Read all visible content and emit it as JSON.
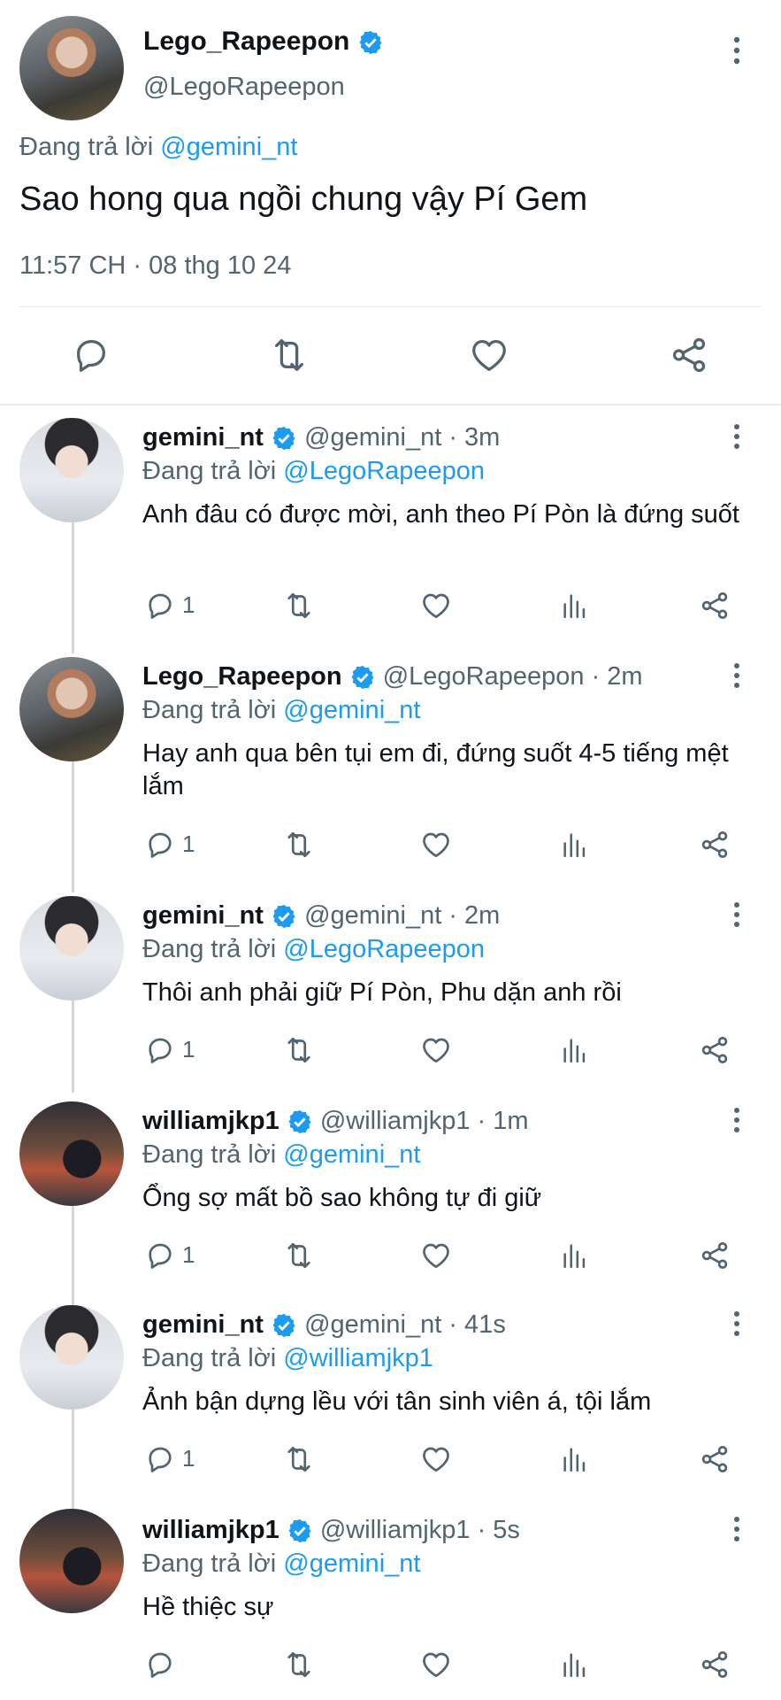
{
  "main_tweet": {
    "display_name": "Lego_Rapeepon",
    "handle": "@LegoRapeepon",
    "reply_prefix": "Đang trả lời",
    "reply_to": "@gemini_nt",
    "text": "Sao hong qua ngồi chung vậy Pí Gem",
    "timestamp": "11:57 CH · 08 thg 10 24",
    "action_icons": [
      "reply-icon",
      "retweet-icon",
      "like-icon",
      "share-icon"
    ]
  },
  "replies": [
    {
      "display_name": "gemini_nt",
      "handle": "@gemini_nt",
      "time": "· 3m",
      "reply_prefix": "Đang trả lời",
      "reply_to": "@LegoRapeepon",
      "text": "Anh đâu có được mời, anh theo Pí Pòn là đứng suốt",
      "reply_count": "1"
    },
    {
      "display_name": "Lego_Rapeepon",
      "handle": "@LegoRapeepon",
      "time": "· 2m",
      "reply_prefix": "Đang trả lời",
      "reply_to": "@gemini_nt",
      "text": "Hay anh qua bên tụi em đi, đứng suốt 4-5 tiếng mệt lắm",
      "reply_count": "1"
    },
    {
      "display_name": "gemini_nt",
      "handle": "@gemini_nt",
      "time": "· 2m",
      "reply_prefix": "Đang trả lời",
      "reply_to": "@LegoRapeepon",
      "text": "Thôi anh phải giữ Pí Pòn, Phu dặn anh rồi",
      "reply_count": "1"
    },
    {
      "display_name": "williamjkp1",
      "handle": "@williamjkp1",
      "time": "· 1m",
      "reply_prefix": "Đang trả lời",
      "reply_to": "@gemini_nt",
      "text": "Ổng sợ mất bồ sao không tự đi giữ",
      "reply_count": "1"
    },
    {
      "display_name": "gemini_nt",
      "handle": "@gemini_nt",
      "time": "· 41s",
      "reply_prefix": "Đang trả lời",
      "reply_to": "@williamjkp1",
      "text": "Ảnh bận dựng lều với tân sinh viên á, tội lắm",
      "reply_count": "1"
    },
    {
      "display_name": "williamjkp1",
      "handle": "@williamjkp1",
      "time": "· 5s",
      "reply_prefix": "Đang trả lời",
      "reply_to": "@gemini_nt",
      "text": "Hề thiệc sự",
      "reply_count": ""
    }
  ],
  "colors": {
    "accent": "#1d9bf0",
    "text": "#0f1419",
    "secondary": "#536471",
    "divider": "#eff3f4"
  },
  "icons": [
    "more-icon",
    "verified-badge-icon",
    "reply-icon",
    "retweet-icon",
    "like-icon",
    "views-icon",
    "share-icon"
  ]
}
